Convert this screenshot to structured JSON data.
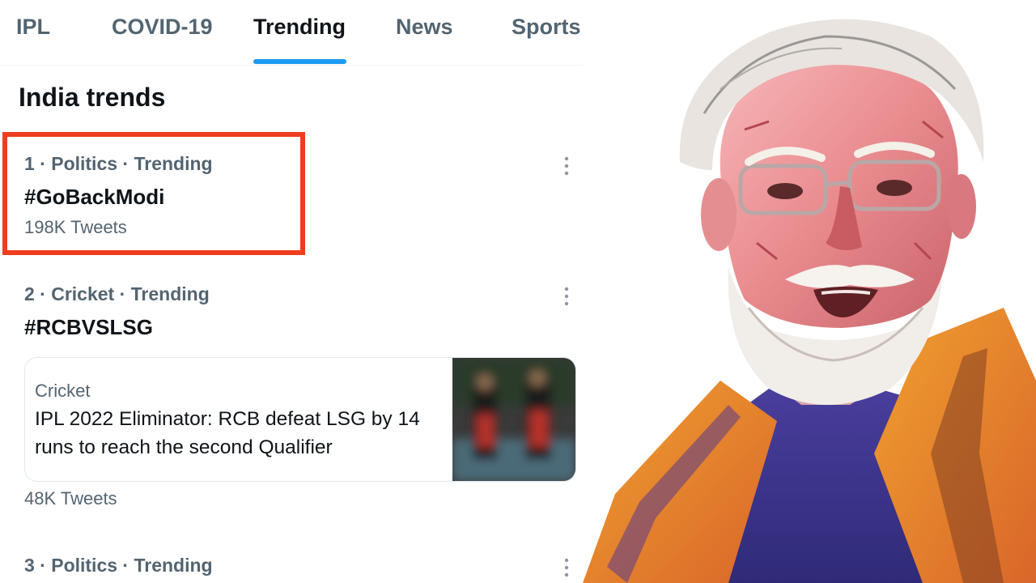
{
  "tabs": [
    {
      "label": "IPL",
      "active": false
    },
    {
      "label": "COVID-19",
      "active": false
    },
    {
      "label": "Trending",
      "active": true
    },
    {
      "label": "News",
      "active": false
    },
    {
      "label": "Sports",
      "active": false
    }
  ],
  "section_title": "India trends",
  "trends": [
    {
      "meta": "1 · Politics · Trending",
      "name": "#GoBackModi",
      "count": "198K Tweets",
      "highlighted": true
    },
    {
      "meta": "2 · Cricket · Trending",
      "name": "#RCBVSLSG",
      "card": {
        "category": "Cricket",
        "headline": "IPL 2022 Eliminator: RCB defeat LSG by 14 runs to reach the second Qualifier"
      },
      "count": "48K Tweets"
    },
    {
      "meta": "3 · Politics · Trending"
    }
  ],
  "colors": {
    "accent": "#1d9bf0",
    "highlight": "#ef3e1f",
    "secondary_text": "#536471",
    "primary_text": "#0f1419"
  },
  "icons": {
    "more": "more-vertical-icon"
  },
  "illustration": {
    "description_label": "portrait-illustration"
  }
}
